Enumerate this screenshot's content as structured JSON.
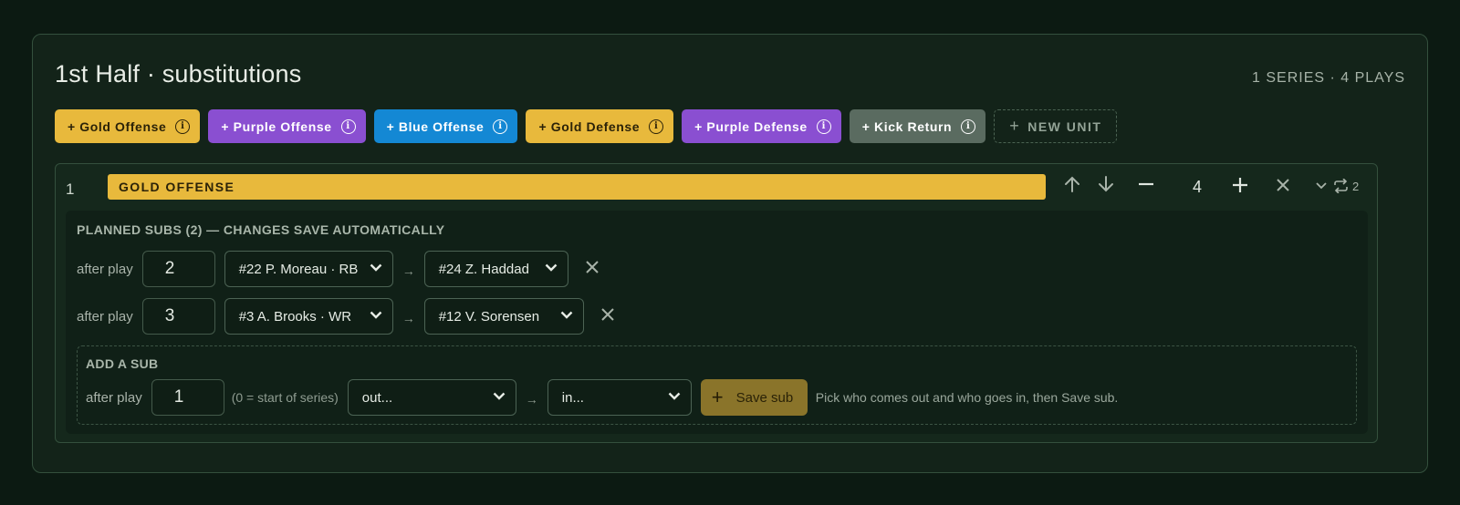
{
  "header": {
    "title": "1st Half · substitutions",
    "summary": "1 SERIES · 4 PLAYS"
  },
  "units": [
    {
      "label": "+ Gold Offense",
      "color": "#e8b93c"
    },
    {
      "label": "+ Purple Offense",
      "color": "#8a4fd1"
    },
    {
      "label": "+ Blue Offense",
      "color": "#1488d4"
    },
    {
      "label": "+ Gold Defense",
      "color": "#e8b93c"
    },
    {
      "label": "+ Purple Defense",
      "color": "#8a4fd1"
    },
    {
      "label": "+ Kick Return",
      "color": "#5a6b60"
    }
  ],
  "new_unit_label": "NEW UNIT",
  "series": {
    "number": "1",
    "unit": "GOLD OFFENSE",
    "plays": "4",
    "repeat_count": "2",
    "subs_heading": "PLANNED SUBS (2) — CHANGES SAVE AUTOMATICALLY",
    "after_play_label": "after play",
    "arrow": "→",
    "subs": [
      {
        "after_play": "2",
        "out": "#22 P. Moreau · RB",
        "in": "#24 Z. Haddad"
      },
      {
        "after_play": "3",
        "out": "#3 A. Brooks · WR",
        "in": "#12 V. Sorensen"
      }
    ],
    "add": {
      "heading": "ADD A SUB",
      "after_play_label": "after play",
      "after_play": "1",
      "hint": "(0 = start of series)",
      "out_placeholder": "out...",
      "in_placeholder": "in...",
      "save_label": "Save sub",
      "helper": "Pick who comes out and who goes in, then Save sub."
    }
  }
}
